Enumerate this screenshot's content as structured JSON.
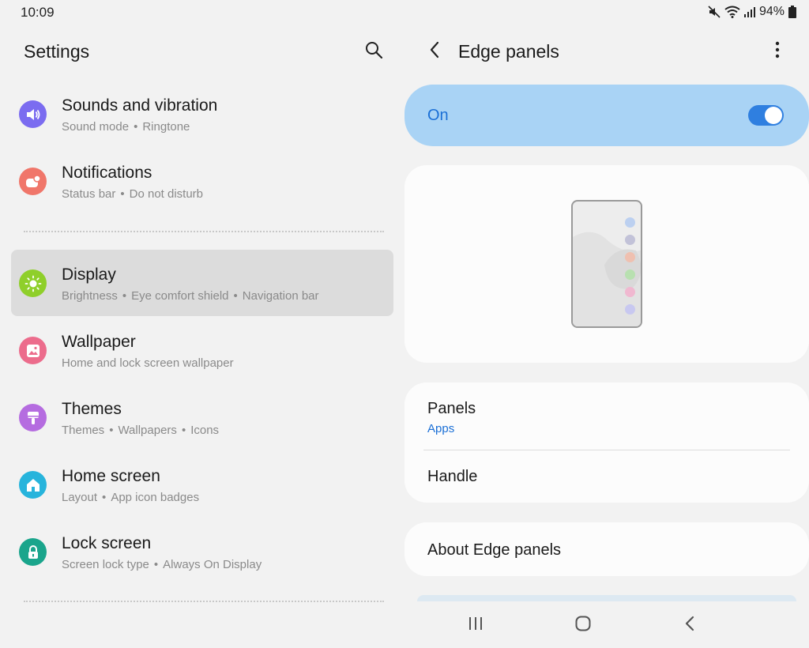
{
  "status": {
    "time": "10:09",
    "battery": "94%",
    "icons": [
      "mute-icon",
      "wifi-icon",
      "signal-icon",
      "battery-icon"
    ]
  },
  "left": {
    "title": "Settings",
    "items": [
      {
        "title": "Sounds and vibration",
        "sub": [
          "Sound mode",
          "Ringtone"
        ],
        "icon": "speaker-icon",
        "color": "#7b6cf0"
      },
      {
        "title": "Notifications",
        "sub": [
          "Status bar",
          "Do not disturb"
        ],
        "icon": "notification-icon",
        "color": "#f0766a"
      },
      {
        "title": "Display",
        "sub": [
          "Brightness",
          "Eye comfort shield",
          "Navigation bar"
        ],
        "icon": "sun-icon",
        "color": "#8fcf2a",
        "selected": true
      },
      {
        "title": "Wallpaper",
        "sub": [
          "Home and lock screen wallpaper"
        ],
        "icon": "image-icon",
        "color": "#ec6c8c"
      },
      {
        "title": "Themes",
        "sub": [
          "Themes",
          "Wallpapers",
          "Icons"
        ],
        "icon": "paintbrush-icon",
        "color": "#b56ce0"
      },
      {
        "title": "Home screen",
        "sub": [
          "Layout",
          "App icon badges"
        ],
        "icon": "home-icon",
        "color": "#27b4dc"
      },
      {
        "title": "Lock screen",
        "sub": [
          "Screen lock type",
          "Always On Display"
        ],
        "icon": "lock-icon",
        "color": "#1aa58c"
      }
    ]
  },
  "right": {
    "title": "Edge panels",
    "switch_label": "On",
    "switch_on": true,
    "edge_dot_colors": [
      "#bcd0f0",
      "#c2c2d8",
      "#efc0b0",
      "#b8e0b0",
      "#f0b8d0",
      "#c8c8f0"
    ],
    "panels": {
      "title": "Panels",
      "sub": "Apps"
    },
    "handle": {
      "title": "Handle"
    },
    "about": {
      "title": "About Edge panels"
    }
  },
  "nav": {
    "items": [
      "recents-icon",
      "home-nav-icon",
      "back-nav-icon"
    ]
  }
}
